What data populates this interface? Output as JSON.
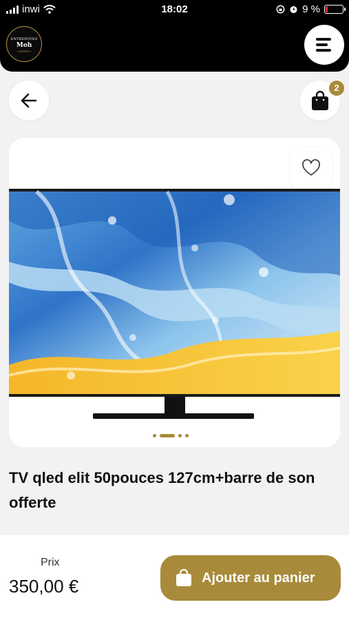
{
  "status_bar": {
    "carrier": "inwi",
    "time": "18:02",
    "battery": "9 %"
  },
  "header": {
    "logo_line1": "ENTREPOTES",
    "logo_line2": "Moh",
    "logo_line3": "~store~",
    "menu_icon": "hamburger-menu-icon"
  },
  "nav": {
    "back_icon": "arrow-left-icon",
    "cart_icon": "shopping-bag-icon",
    "cart_count": "2"
  },
  "product": {
    "title": "TV qled elit 50pouces 127cm+barre de son offerte",
    "favorite_icon": "heart-icon",
    "image_pages": 4,
    "active_image": 2
  },
  "footer": {
    "price_label": "Prix",
    "price": "350,00 €",
    "add_to_cart": "Ajouter au panier"
  },
  "colors": {
    "accent": "#a88a3a",
    "header_bg": "#000000",
    "page_bg": "#f2f2f2"
  }
}
